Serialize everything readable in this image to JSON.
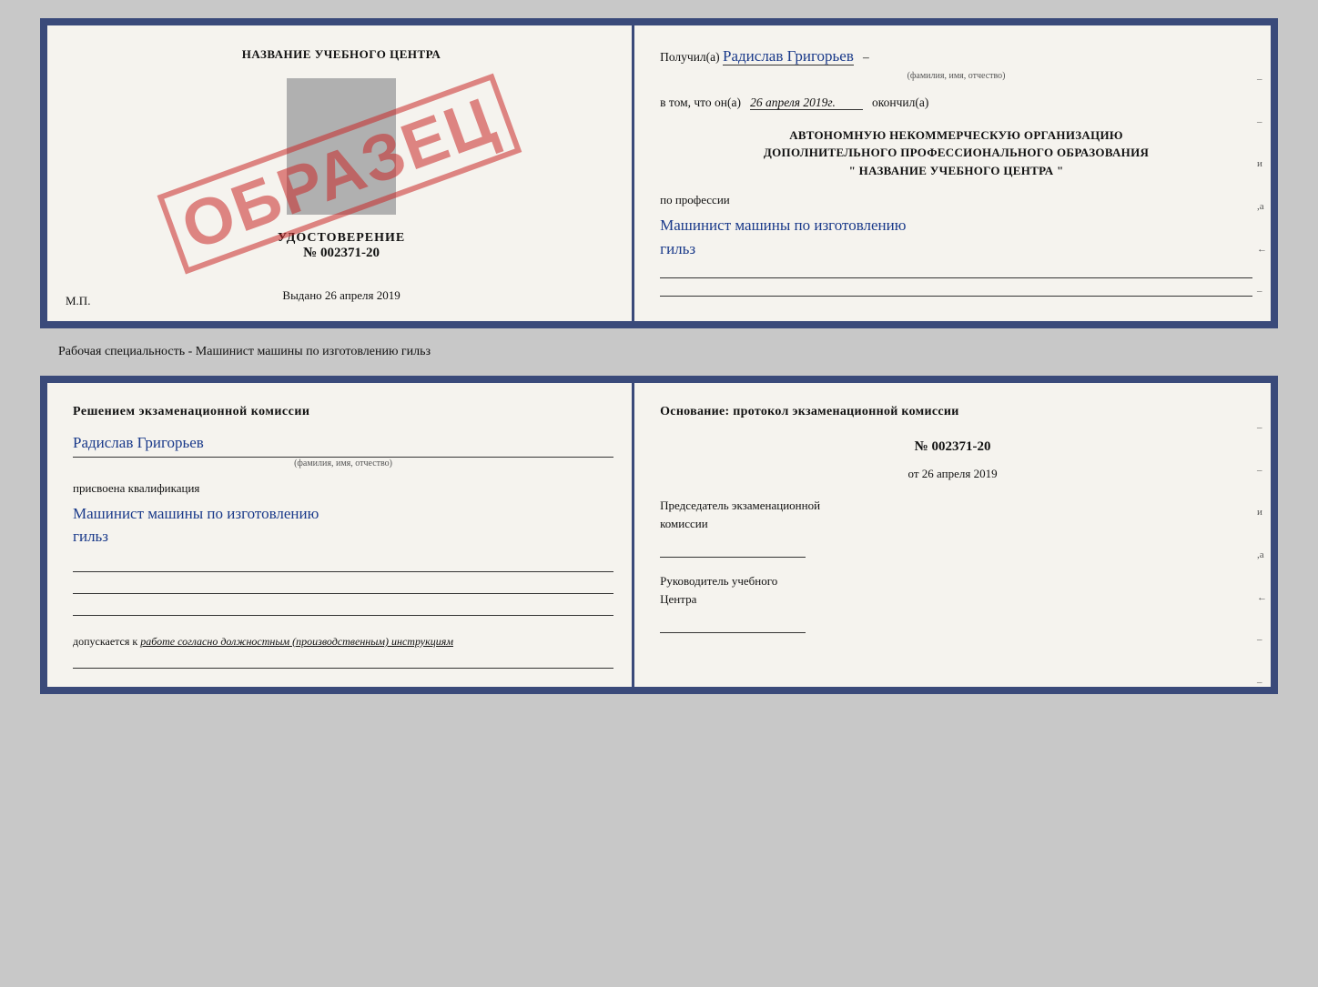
{
  "top_left": {
    "title": "НАЗВАНИЕ УЧЕБНОГО ЦЕНТРА",
    "stamp": "ОБРАЗЕЦ",
    "cert_label": "УДОСТОВЕРЕНИЕ",
    "cert_number": "№ 002371-20",
    "vydano": "Выдано",
    "vydano_date": "26 апреля 2019",
    "mp": "М.П."
  },
  "top_right": {
    "poluchil": "Получил(а)",
    "name": "Радислав Григорьев",
    "fio_hint": "(фамилия, имя, отчество)",
    "vtom_prefix": "в том, что он(а)",
    "vtom_date": "26 апреля 2019г.",
    "okonchil": "окончил(а)",
    "org_line1": "АВТОНОМНУЮ НЕКОММЕРЧЕСКУЮ ОРГАНИЗАЦИЮ",
    "org_line2": "ДОПОЛНИТЕЛЬНОГО ПРОФЕССИОНАЛЬНОГО ОБРАЗОВАНИЯ",
    "org_line3": "\"   НАЗВАНИЕ УЧЕБНОГО ЦЕНТРА   \"",
    "poprofessii": "по профессии",
    "profession1": "Машинист машины по изготовлению",
    "profession2": "гильз"
  },
  "between_label": "Рабочая специальность - Машинист машины по изготовлению гильз",
  "bottom_left": {
    "komissia_title": "Решением  экзаменационной  комиссии",
    "name": "Радислав Григорьев",
    "fio_hint": "(фамилия, имя, отчество)",
    "prisvoena": "присвоена квалификация",
    "kvali1": "Машинист  машины  по изготовлению",
    "kvali2": "гильз",
    "dopuskaetsya": "допускается к",
    "dopuskaetsya_text": "работе согласно должностным (производственным) инструкциям"
  },
  "bottom_right": {
    "osnovanie": "Основание: протокол экзаменационной  комиссии",
    "number": "№  002371-20",
    "ot_prefix": "от",
    "ot_date": "26 апреля 2019",
    "predsedatel_label": "Председатель экзаменационной",
    "predsedatel_label2": "комиссии",
    "rukovoditel_label": "Руководитель учебного",
    "rukovoditel_label2": "Центра"
  },
  "side_dashes": [
    "-",
    "-",
    "и",
    "а",
    "←",
    "-",
    "-",
    "-"
  ]
}
